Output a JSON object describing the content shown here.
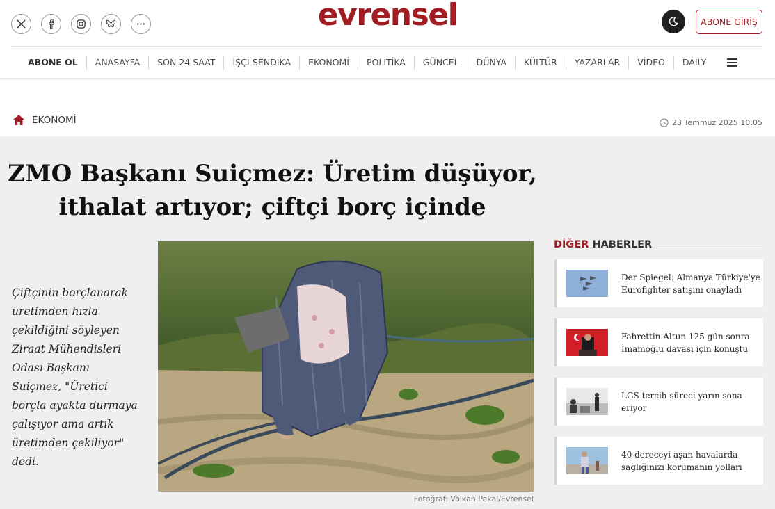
{
  "site": {
    "logo": "evrensel"
  },
  "header": {
    "social_icons": [
      "x-icon",
      "facebook-icon",
      "instagram-icon",
      "bluesky-icon",
      "more-icon"
    ],
    "dark_mode_icon": "moon-icon",
    "login_label": "ABONE GİRİŞ"
  },
  "nav": {
    "items": [
      "ABONE OL",
      "ANASAYFA",
      "SON 24 SAAT",
      "İŞÇİ-SENDİKA",
      "EKONOMİ",
      "POLİTİKA",
      "GÜNCEL",
      "DÜNYA",
      "KÜLTÜR",
      "YAZARLAR",
      "VİDEO",
      "DAILY"
    ],
    "menu_icon": "hamburger-icon"
  },
  "breadcrumb": {
    "icon": "home-icon",
    "category": "EKONOMİ"
  },
  "article": {
    "date": "23 Temmuz 2025 10:05",
    "headline_line1": "ZMO Başkanı Suiçmez: Üretim düşüyor,",
    "headline_line2": "ithalat artıyor; çiftçi borç içinde",
    "lead": "Çiftçinin borçlanarak üretimden hızla çekildiğini söyleyen Ziraat Mühendisleri Odası Başkanı Suiçmez, \"Üretici borçla ayakta durmaya çalışıyor ama artık üretimden çekiliyor\" dedi.",
    "photo_caption": "Fotoğraf: Volkan Pekal/Evrensel"
  },
  "sidebar": {
    "title_red": "DİĞER",
    "title_dark": "HABERLER",
    "items": [
      {
        "title": "Der Spiegel: Almanya Türkiye'ye Eurofighter satışını onayladı"
      },
      {
        "title": "Fahrettin Altun 125 gün sonra İmamoğlu davası için konuştu"
      },
      {
        "title": "LGS tercih süreci yarın sona eriyor"
      },
      {
        "title": "40 dereceyi aşan havalarda sağlığınızı korumanın yolları"
      }
    ]
  },
  "colors": {
    "brand": "#a21c24",
    "page_bg": "#efefef",
    "dark_button": "#1f1f1f"
  }
}
